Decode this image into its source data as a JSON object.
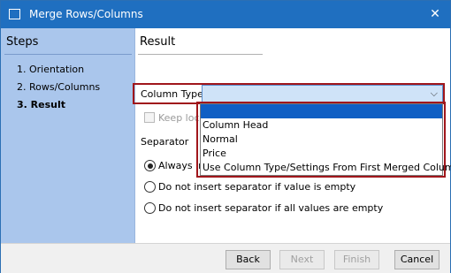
{
  "window": {
    "title": "Merge Rows/Columns",
    "close_glyph": "✕"
  },
  "sidebar": {
    "heading": "Steps",
    "steps": [
      {
        "label": "1. Orientation"
      },
      {
        "label": "2. Rows/Columns"
      },
      {
        "label": "3. Result"
      }
    ],
    "active_step": 3
  },
  "main": {
    "heading": "Result",
    "column_type": {
      "label": "Column Type",
      "value": ""
    },
    "keep_option": {
      "label": "Keep loca",
      "checked": false,
      "enabled": false
    },
    "separator": {
      "label": "Separator",
      "options": [
        {
          "label": "Always in",
          "checked": true
        },
        {
          "label": "Do not insert separator if value is empty",
          "checked": false
        },
        {
          "label": "Do not insert separator if all values are empty",
          "checked": false
        }
      ]
    },
    "dropdown": {
      "options": [
        {
          "label": "",
          "highlighted": true
        },
        {
          "label": "Column Head"
        },
        {
          "label": "Normal"
        },
        {
          "label": "Price"
        },
        {
          "label": "Use Column Type/Settings From First Merged Column"
        }
      ]
    }
  },
  "buttons": {
    "back": "Back",
    "next": "Next",
    "finish": "Finish",
    "cancel": "Cancel"
  },
  "colors": {
    "titlebar": "#1f6fc0",
    "sidebar": "#aac6ec",
    "highlight_frame": "#a0161b",
    "dropdown_selected": "#0f5fc4"
  }
}
